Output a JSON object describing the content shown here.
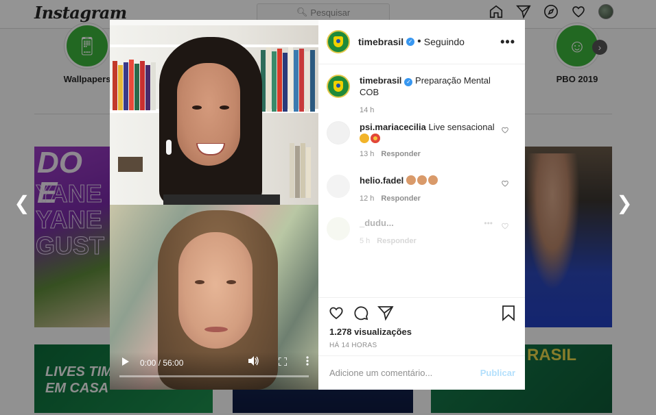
{
  "topbar": {
    "logo": "Instagram",
    "search_placeholder": "Pesquisar"
  },
  "highlights": [
    {
      "label": "Wallpapers"
    },
    {
      "label": "PBO 2019"
    }
  ],
  "video": {
    "time": "0:00 / 56:00",
    "progress": 0
  },
  "post": {
    "username": "timebrasil",
    "follow_status": "Seguindo",
    "separator": "•",
    "caption_user": "timebrasil",
    "caption": "Preparação Mental COB",
    "caption_time": "14 h",
    "comments": [
      {
        "user": "psi.mariacecilia",
        "text": "Live sensacional",
        "time": "13 h",
        "reply": "Responder"
      },
      {
        "user": "helio.fadel",
        "text": "",
        "time": "12 h",
        "reply": "Responder"
      },
      {
        "user": "_dudu...",
        "text": "",
        "time": "5 h",
        "reply": "Responder"
      }
    ],
    "views": "1.278 visualizações",
    "posted": "HÁ 14 HORAS",
    "comment_placeholder": "Adicione um comentário...",
    "publish": "Publicar"
  },
  "tiles": {
    "tile3_text": "LIVES TIME EM CASA",
    "tile5_text": "RASIL"
  },
  "colors": {
    "accent_blue": "#3897f0",
    "brand_green": "#1f8a3a",
    "publish_disabled": "#b2dffc"
  }
}
